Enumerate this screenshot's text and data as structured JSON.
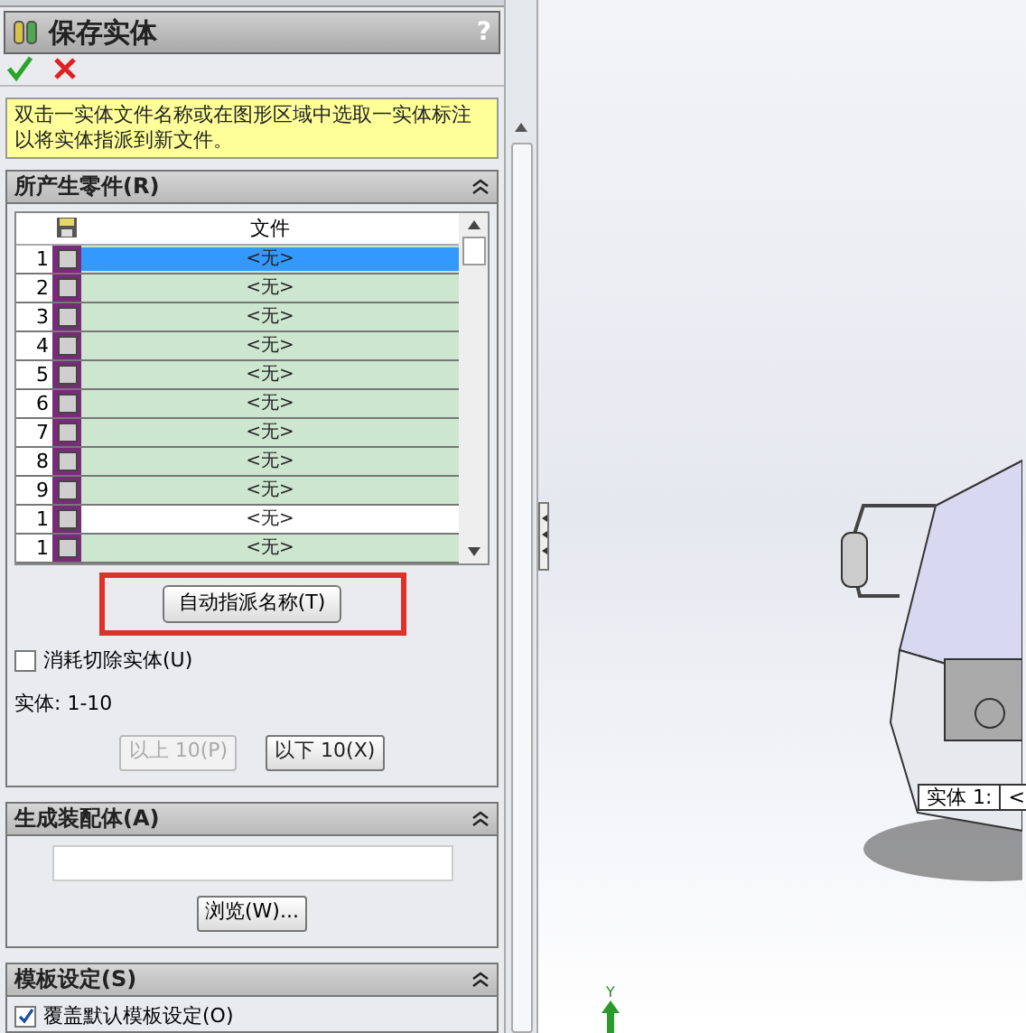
{
  "panel": {
    "title": "保存实体",
    "help": "?",
    "message": "双击一实体文件名称或在图形区域中选取一实体标注以将实体指派到新文件。"
  },
  "parts_section": {
    "title": "所产生零件(R)",
    "column": "文件",
    "rows": [
      {
        "index": "1",
        "file": "<无>",
        "checked": false,
        "selected": true,
        "highlighted": true
      },
      {
        "index": "2",
        "file": "<无>",
        "checked": false,
        "selected": false,
        "highlighted": true
      },
      {
        "index": "3",
        "file": "<无>",
        "checked": false,
        "selected": false,
        "highlighted": true
      },
      {
        "index": "4",
        "file": "<无>",
        "checked": false,
        "selected": false,
        "highlighted": true
      },
      {
        "index": "5",
        "file": "<无>",
        "checked": false,
        "selected": false,
        "highlighted": true
      },
      {
        "index": "6",
        "file": "<无>",
        "checked": false,
        "selected": false,
        "highlighted": true
      },
      {
        "index": "7",
        "file": "<无>",
        "checked": false,
        "selected": false,
        "highlighted": true
      },
      {
        "index": "8",
        "file": "<无>",
        "checked": false,
        "selected": false,
        "highlighted": true
      },
      {
        "index": "9",
        "file": "<无>",
        "checked": false,
        "selected": false,
        "highlighted": true
      },
      {
        "index": "1",
        "file": "<无>",
        "checked": false,
        "selected": false,
        "highlighted": false
      },
      {
        "index": "1",
        "file": "<无>",
        "checked": false,
        "selected": false,
        "highlighted": true
      }
    ],
    "auto_button": "自动指派名称(T)",
    "consume": {
      "label": "消耗切除实体(U)",
      "checked": false
    },
    "range": "实体: 1-10",
    "prev_button": {
      "label": "以上 10(P)",
      "disabled": true
    },
    "next_button": {
      "label": "以下 10(X)",
      "disabled": false
    }
  },
  "assembly_section": {
    "title": "生成装配体(A)",
    "browse": "浏览(W)..."
  },
  "template_section": {
    "title": "模板设定(S)",
    "override": {
      "label": "覆盖默认模板设定(O)",
      "checked": true
    }
  },
  "viewport": {
    "callout": "实体 1:",
    "callout_value": "<",
    "axis_label": "Y"
  }
}
